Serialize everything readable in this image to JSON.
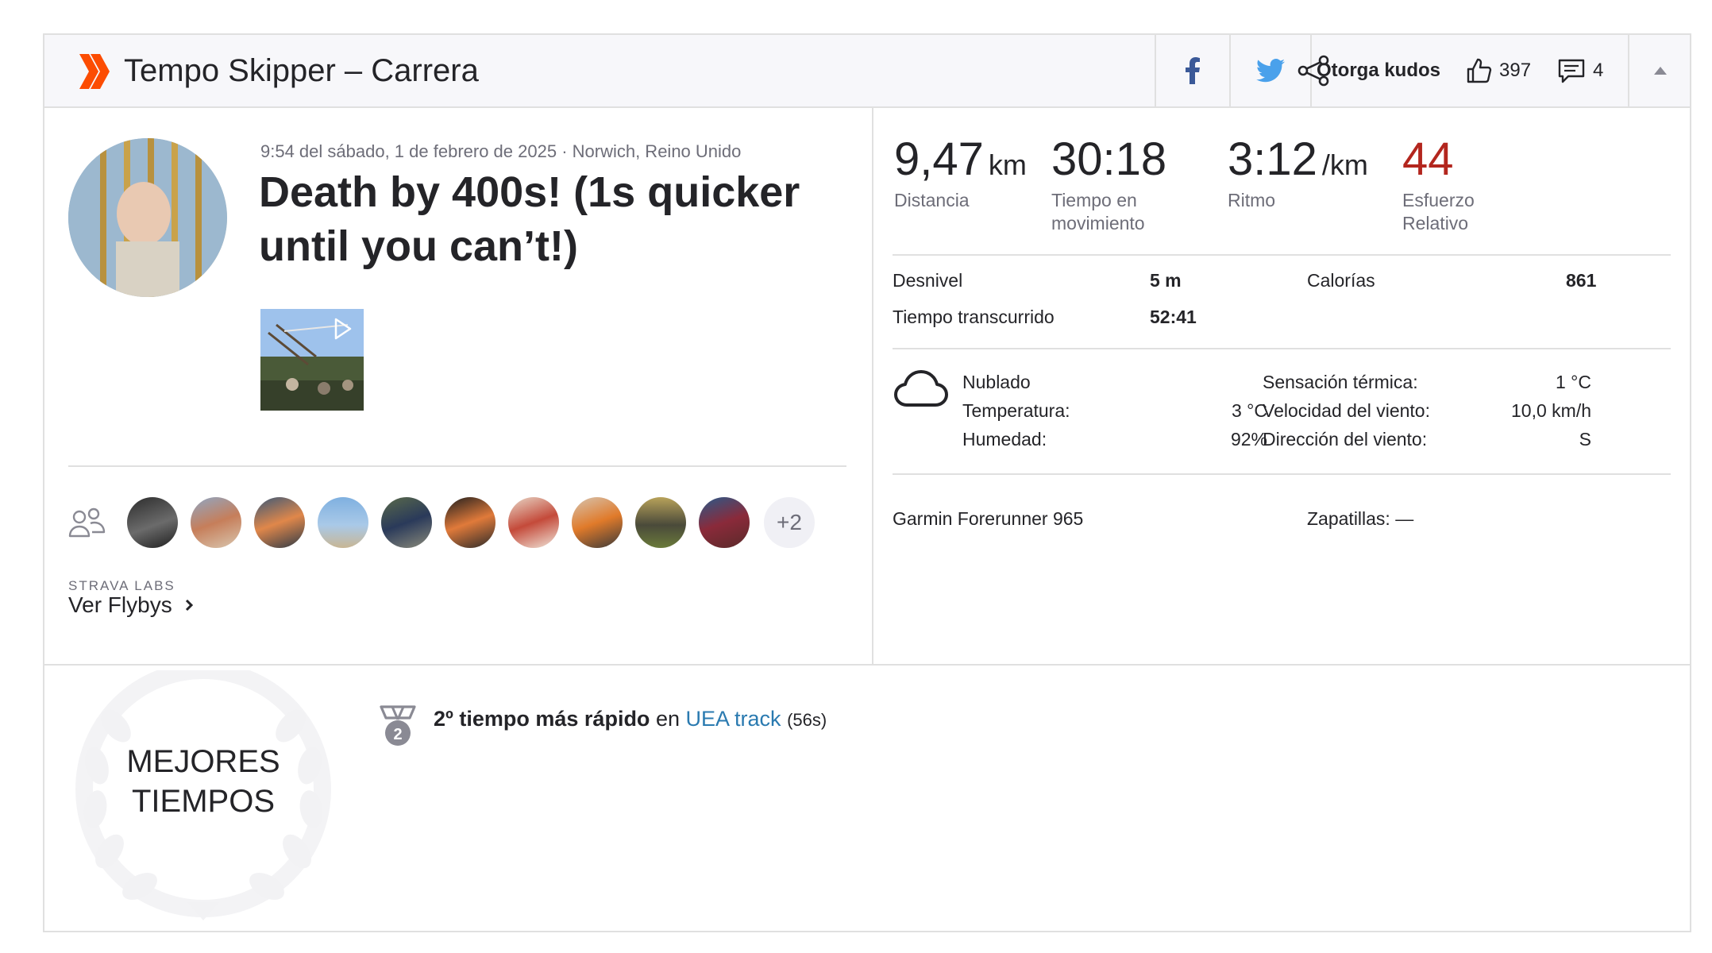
{
  "header": {
    "title": "Tempo Skipper – Carrera",
    "kudos_label": "Otorga kudos",
    "kudos_count": "397",
    "comments_count": "4",
    "icons": [
      "strava-chevrons-logo",
      "facebook-icon",
      "twitter-icon",
      "share-icon",
      "thumbs-up-icon",
      "comment-icon",
      "collapse-arrow-icon"
    ],
    "brand_color": "#fc4c02"
  },
  "activity": {
    "meta": "9:54 del sábado, 1 de febrero de 2025 · Norwich, Reino Unido",
    "title": "Death by 400s! (1s quicker until you can’t!)"
  },
  "group": {
    "more_label": "+2",
    "labs_label": "STRAVA LABS",
    "flyby_label": "Ver Flybys"
  },
  "stats": {
    "distance": {
      "value": "9,47",
      "unit": "km",
      "label": "Distancia"
    },
    "moving_time": {
      "value": "30:18",
      "label": "Tiempo en movimiento"
    },
    "pace": {
      "value": "3:12",
      "unit": "/km",
      "label": "Ritmo"
    },
    "relative_effort": {
      "value": "44",
      "label": "Esfuerzo Relativo",
      "color": "#b3261e"
    }
  },
  "details": {
    "elevation_label": "Desnivel",
    "elevation_value": "5 m",
    "calories_label": "Calorías",
    "calories_value": "861",
    "elapsed_label": "Tiempo transcurrido",
    "elapsed_value": "52:41"
  },
  "weather": {
    "condition": "Nublado",
    "temp_label": "Temperatura:",
    "temp_value": "3 °C",
    "humidity_label": "Humedad:",
    "humidity_value": "92%",
    "feels_label": "Sensación térmica:",
    "feels_value": "1 °C",
    "wind_speed_label": "Velocidad del viento:",
    "wind_speed_value": "10,0 km/h",
    "wind_dir_label": "Dirección del viento:",
    "wind_dir_value": "S"
  },
  "gear": {
    "device": "Garmin Forerunner 965",
    "shoes": "Zapatillas: —"
  },
  "best_efforts": {
    "title_line1": "MEJORES",
    "title_line2": "TIEMPOS",
    "rank": "2º tiempo más rápido",
    "connector": "en",
    "segment": "UEA track",
    "time": "(56s)",
    "medal_number": "2"
  }
}
